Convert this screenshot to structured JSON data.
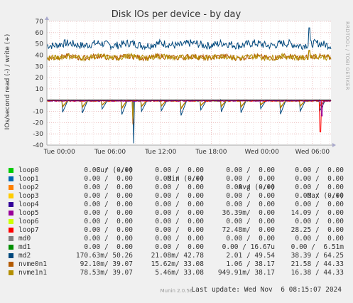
{
  "title": "Disk IOs per device - by day",
  "side_label": "RRDTOOL / TOBI OETIKER",
  "legend_header": {
    "cur": "Cur (-/+)",
    "min": "Min (-/+)",
    "avg": "Avg (-/+)",
    "max": "Max (-/+)"
  },
  "legend": [
    {
      "name": "loop0",
      "color": "#00cc00",
      "cur": "0.00 /  0.00",
      "min": "0.00 /  0.00",
      "avg": "0.00 /  0.00",
      "max": "0.00 /  0.00"
    },
    {
      "name": "loop1",
      "color": "#0066b3",
      "cur": "0.00 /  0.00",
      "min": "0.00 /  0.00",
      "avg": "0.00 /  0.00",
      "max": "0.00 /  0.00"
    },
    {
      "name": "loop2",
      "color": "#ff8000",
      "cur": "0.00 /  0.00",
      "min": "0.00 /  0.00",
      "avg": "0.00 /  0.00",
      "max": "0.00 /  0.00"
    },
    {
      "name": "loop3",
      "color": "#ffcc00",
      "cur": "0.00 /  0.00",
      "min": "0.00 /  0.00",
      "avg": "0.00 /  0.00",
      "max": "0.00 /  0.00"
    },
    {
      "name": "loop4",
      "color": "#330099",
      "cur": "0.00 /  0.00",
      "min": "0.00 /  0.00",
      "avg": "0.00 /  0.00",
      "max": "0.00 /  0.00"
    },
    {
      "name": "loop5",
      "color": "#990099",
      "cur": "0.00 /  0.00",
      "min": "0.00 /  0.00",
      "avg": "36.39m/  0.00",
      "max": "14.09 /  0.00"
    },
    {
      "name": "loop6",
      "color": "#ccff00",
      "cur": "0.00 /  0.00",
      "min": "0.00 /  0.00",
      "avg": "0.00 /  0.00",
      "max": "0.00 /  0.00"
    },
    {
      "name": "loop7",
      "color": "#ff0000",
      "cur": "0.00 /  0.00",
      "min": "0.00 /  0.00",
      "avg": "72.48m/  0.00",
      "max": "28.25 /  0.00"
    },
    {
      "name": "md0",
      "color": "#808080",
      "cur": "0.00 /  0.00",
      "min": "0.00 /  0.00",
      "avg": "0.00 /  0.00",
      "max": "0.00 /  0.00"
    },
    {
      "name": "md1",
      "color": "#008f00",
      "cur": "0.00 /  0.00",
      "min": "0.00 /  0.00",
      "avg": "0.00 / 16.67u",
      "max": "0.00 /  6.51m"
    },
    {
      "name": "md2",
      "color": "#00487d",
      "cur": "170.63m/ 50.26",
      "min": "21.08m/ 42.78",
      "avg": "2.01 / 49.54",
      "max": "38.39 / 64.25"
    },
    {
      "name": "nvme0n1",
      "color": "#b35a00",
      "cur": "92.10m/ 39.07",
      "min": "15.62m/ 33.08",
      "avg": "1.06 / 38.17",
      "max": "21.58 / 44.33"
    },
    {
      "name": "nvme1n1",
      "color": "#b38f00",
      "cur": "78.53m/ 39.07",
      "min": "5.46m/ 33.08",
      "avg": "949.91m/ 38.17",
      "max": "16.38 / 44.33"
    }
  ],
  "last_update": "Last update: Wed Nov  6 08:15:07 2024",
  "footer": "Munin 2.0.56",
  "chart_data": {
    "type": "line",
    "title": "Disk IOs per device - by day",
    "ylabel": "IOs/second read (-) / write (+)",
    "ylim": [
      -40,
      70
    ],
    "yticks": [
      70,
      60,
      50,
      40,
      30,
      20,
      10,
      0,
      -10,
      -20,
      -30,
      -40
    ],
    "x_range_hours": [
      -1.5,
      32.2
    ],
    "xticks": [
      {
        "label": "Tue 00:00",
        "h": 0
      },
      {
        "label": "Tue 06:00",
        "h": 6
      },
      {
        "label": "Tue 12:00",
        "h": 12
      },
      {
        "label": "Tue 18:00",
        "h": 18
      },
      {
        "label": "Wed 00:00",
        "h": 24
      },
      {
        "label": "Wed 06:00",
        "h": 30
      }
    ],
    "grid": true,
    "series": [
      {
        "name": "md2",
        "color": "#00487d",
        "write_mean": 49.5,
        "write_amp": 3.5,
        "read_dip": -14,
        "write_peaks": [
          {
            "h": 29.6,
            "v": 64.25
          }
        ],
        "read_peaks": [
          {
            "h": 8.8,
            "v": -38.4
          }
        ]
      },
      {
        "name": "nvme0n1",
        "color": "#b35a00",
        "write_mean": 38.2,
        "write_amp": 2.5,
        "read_dip": -8,
        "write_peaks": [
          {
            "h": 29.6,
            "v": 44.3
          }
        ],
        "read_peaks": [
          {
            "h": 8.7,
            "v": -21.6
          }
        ]
      },
      {
        "name": "nvme1n1",
        "color": "#b38f00",
        "write_mean": 38.2,
        "write_amp": 2.5,
        "read_dip": -7,
        "write_peaks": [
          {
            "h": 29.6,
            "v": 44.3
          }
        ],
        "read_peaks": [
          {
            "h": 8.7,
            "v": -16.4
          }
        ]
      },
      {
        "name": "loop7",
        "color": "#ff0000",
        "write_mean": 0,
        "write_amp": 0,
        "read_dip": 0,
        "write_peaks": [],
        "read_peaks": [
          {
            "h": 30.9,
            "v": -28.25
          }
        ]
      },
      {
        "name": "loop5",
        "color": "#990099",
        "write_mean": 0,
        "write_amp": 0,
        "read_dip": 0,
        "write_peaks": [],
        "read_peaks": [
          {
            "h": 31.1,
            "v": -14.09
          }
        ]
      }
    ]
  }
}
